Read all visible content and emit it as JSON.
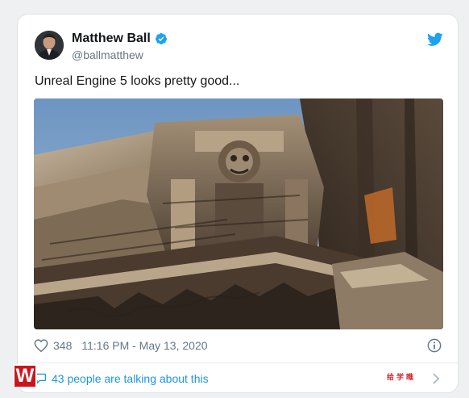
{
  "tweet": {
    "author_name": "Matthew Ball",
    "author_handle": "@ballmatthew",
    "text": "Unreal Engine 5 looks pretty good...",
    "likes": "348",
    "timestamp": "11:16 PM - May 13, 2020",
    "discussion": "43 people are talking about this",
    "verified": true
  },
  "icons": {
    "verified": "verified-badge-icon",
    "twitter": "twitter-bird-icon",
    "like": "heart-icon",
    "info": "info-icon",
    "reply": "comment-bubble-icon",
    "next": "chevron-right-icon"
  },
  "watermark": {
    "logo_text": "W",
    "caption": "给学瞧"
  },
  "colors": {
    "accent": "#1da1f2",
    "link": "#1b95e0",
    "text": "#14171a",
    "muted": "#657786",
    "watermark": "#c9161d"
  }
}
